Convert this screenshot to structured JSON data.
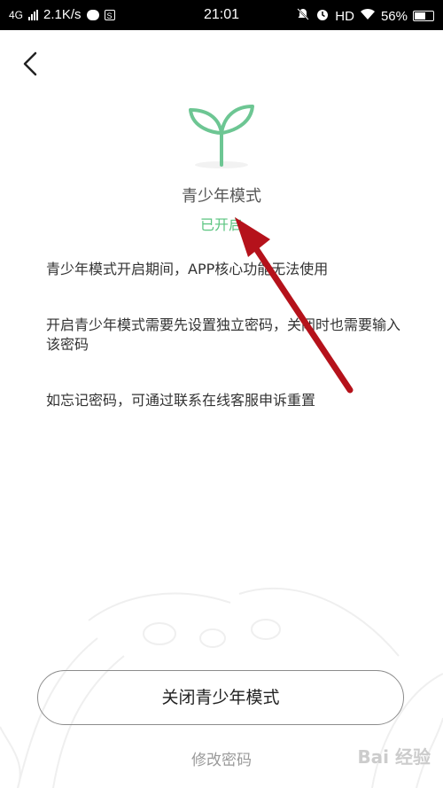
{
  "status_bar": {
    "network": "4G",
    "speed": "2.1K/s",
    "time": "21:01",
    "hd": "HD",
    "battery": "56%"
  },
  "header": {
    "back_icon": "chevron-left-icon"
  },
  "hero": {
    "icon": "sprout-icon",
    "title": "青少年模式",
    "status": "已开启",
    "status_color": "#5cc581"
  },
  "info": {
    "line1": "青少年模式开启期间，APP核心功能无法使用",
    "line2": "开启青少年模式需要先设置独立密码，关闭时也需要输入该密码",
    "line3": "如忘记密码，可通过联系在线客服申诉重置"
  },
  "actions": {
    "close_label": "关闭青少年模式",
    "change_password_label": "修改密码"
  },
  "watermark": "Bai 经验"
}
